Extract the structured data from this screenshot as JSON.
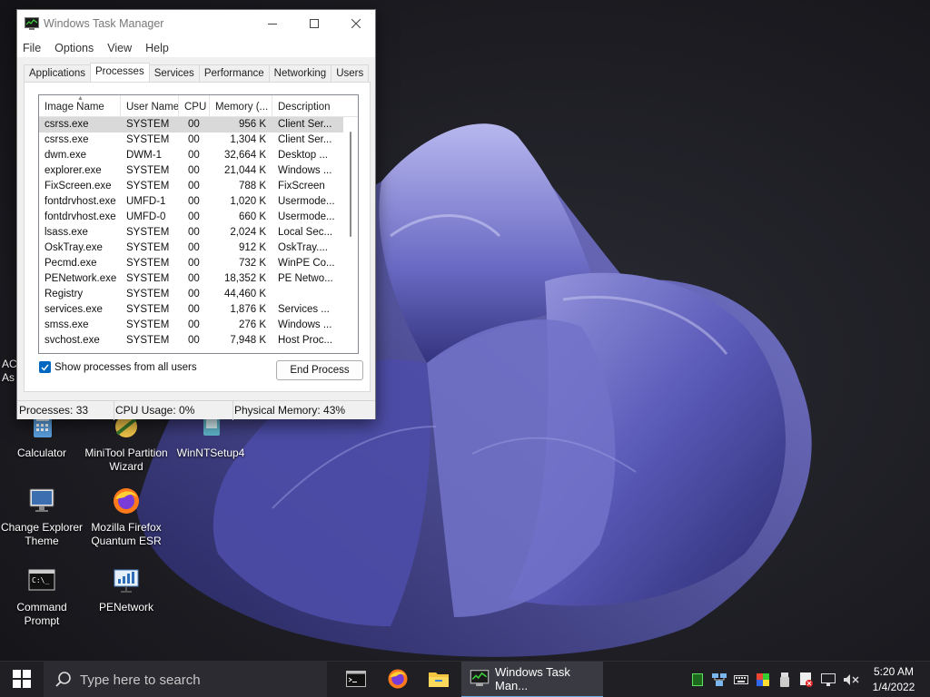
{
  "desktop": {
    "partial_label": "AC\nAs",
    "icons": [
      {
        "label": "Calculator",
        "icon": "calculator-icon"
      },
      {
        "label": "MiniTool Partition Wizard",
        "icon": "minitool-icon"
      },
      {
        "label": "WinNTSetup4",
        "icon": "winntsetup-icon"
      },
      {
        "label": "Change Explorer Theme",
        "icon": "monitor-icon"
      },
      {
        "label": "Mozilla Firefox Quantum ESR",
        "icon": "firefox-icon"
      },
      {
        "label": "Command Prompt",
        "icon": "cmd-icon"
      },
      {
        "label": "PENetwork",
        "icon": "network-icon"
      }
    ]
  },
  "task_manager": {
    "title": "Windows Task Manager",
    "menu": [
      "File",
      "Options",
      "View",
      "Help"
    ],
    "tabs": [
      "Applications",
      "Processes",
      "Services",
      "Performance",
      "Networking",
      "Users"
    ],
    "active_tab": "Processes",
    "columns": [
      "Image Name",
      "User Name",
      "CPU",
      "Memory (...",
      "Description"
    ],
    "rows": [
      {
        "name": "csrss.exe",
        "user": "SYSTEM",
        "cpu": "00",
        "mem": "956 K",
        "desc": "Client Ser...",
        "selected": true
      },
      {
        "name": "csrss.exe",
        "user": "SYSTEM",
        "cpu": "00",
        "mem": "1,304 K",
        "desc": "Client Ser..."
      },
      {
        "name": "dwm.exe",
        "user": "DWM-1",
        "cpu": "00",
        "mem": "32,664 K",
        "desc": "Desktop ..."
      },
      {
        "name": "explorer.exe",
        "user": "SYSTEM",
        "cpu": "00",
        "mem": "21,044 K",
        "desc": "Windows ..."
      },
      {
        "name": "FixScreen.exe",
        "user": "SYSTEM",
        "cpu": "00",
        "mem": "788 K",
        "desc": "FixScreen"
      },
      {
        "name": "fontdrvhost.exe",
        "user": "UMFD-1",
        "cpu": "00",
        "mem": "1,020 K",
        "desc": "Usermode..."
      },
      {
        "name": "fontdrvhost.exe",
        "user": "UMFD-0",
        "cpu": "00",
        "mem": "660 K",
        "desc": "Usermode..."
      },
      {
        "name": "lsass.exe",
        "user": "SYSTEM",
        "cpu": "00",
        "mem": "2,024 K",
        "desc": "Local Sec..."
      },
      {
        "name": "OskTray.exe",
        "user": "SYSTEM",
        "cpu": "00",
        "mem": "912 K",
        "desc": "OskTray...."
      },
      {
        "name": "Pecmd.exe",
        "user": "SYSTEM",
        "cpu": "00",
        "mem": "732 K",
        "desc": "WinPE Co..."
      },
      {
        "name": "PENetwork.exe",
        "user": "SYSTEM",
        "cpu": "00",
        "mem": "18,352 K",
        "desc": "PE Netwo..."
      },
      {
        "name": "Registry",
        "user": "SYSTEM",
        "cpu": "00",
        "mem": "44,460 K",
        "desc": ""
      },
      {
        "name": "services.exe",
        "user": "SYSTEM",
        "cpu": "00",
        "mem": "1,876 K",
        "desc": "Services ..."
      },
      {
        "name": "smss.exe",
        "user": "SYSTEM",
        "cpu": "00",
        "mem": "276 K",
        "desc": "Windows ..."
      },
      {
        "name": "svchost.exe",
        "user": "SYSTEM",
        "cpu": "00",
        "mem": "7,948 K",
        "desc": "Host Proc..."
      }
    ],
    "show_all_users_label": "Show processes from all users",
    "show_all_users_checked": true,
    "end_process_label": "End Process",
    "status": {
      "processes": "Processes: 33",
      "cpu": "CPU Usage: 0%",
      "memory": "Physical Memory: 43%"
    }
  },
  "taskbar": {
    "search_placeholder": "Type here to search",
    "pinned": [
      "cmd-icon",
      "firefox-icon",
      "file-explorer-icon"
    ],
    "active_task_label": "Windows Task Man...",
    "tray_icons": [
      "green-app-icon",
      "network-share-icon",
      "keyboard-icon",
      "color-icon",
      "usb-icon",
      "shield-x-icon",
      "monitor-network-icon",
      "volume-muted-icon"
    ],
    "time": "5:20 AM",
    "date": "1/4/2022"
  },
  "colors": {
    "accent": "#0067c0",
    "wallpaper_bloom": "#5b5bb3",
    "taskbar": "#1f1f24"
  }
}
